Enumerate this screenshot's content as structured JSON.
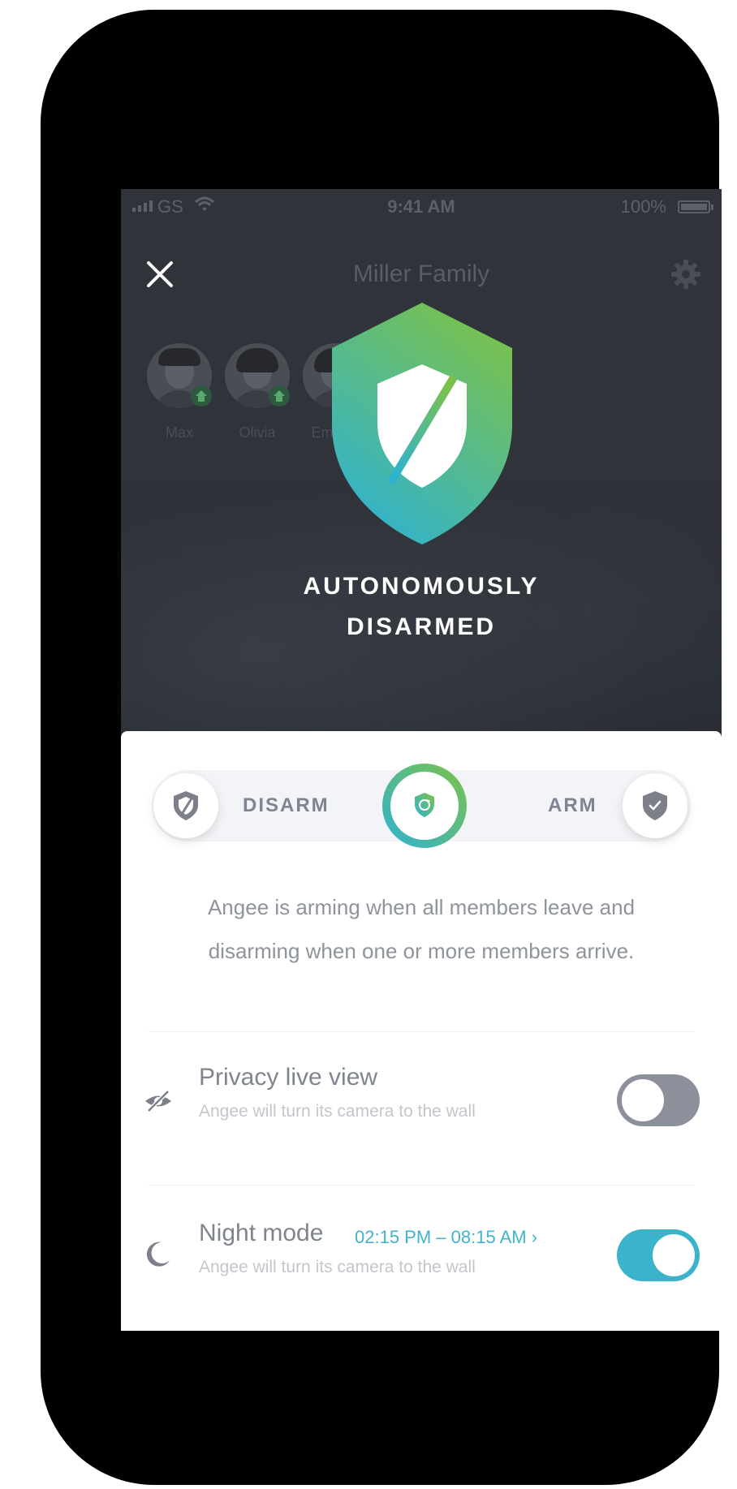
{
  "statusbar": {
    "carrier": "GS",
    "time": "9:41 AM",
    "battery": "100%"
  },
  "header": {
    "title": "Miller Family"
  },
  "members": [
    {
      "name": "Max"
    },
    {
      "name": "Olivia"
    },
    {
      "name": "Em"
    }
  ],
  "status": {
    "line1": "AUTONOMOUSLY",
    "line2": "DISARMED"
  },
  "mode": {
    "disarm_label": "DISARM",
    "arm_label": "ARM"
  },
  "description": {
    "line1": "Angee is arming when all members leave and",
    "line2": "disarming when one or more members arrive."
  },
  "settings": {
    "privacy": {
      "title": "Privacy live view",
      "subtitle": "Angee will turn its camera to the wall",
      "enabled": false
    },
    "night": {
      "title": "Night mode",
      "time_range": "02:15 PM – 08:15 AM ›",
      "subtitle": "Angee will turn its camera to the wall",
      "enabled": true
    }
  },
  "colors": {
    "accent": "#3bb3cb",
    "shield_top": "#7cc24a",
    "shield_bottom": "#2fb2d1",
    "toggle_off": "#8b909a",
    "icon_gray": "#7d8089"
  }
}
